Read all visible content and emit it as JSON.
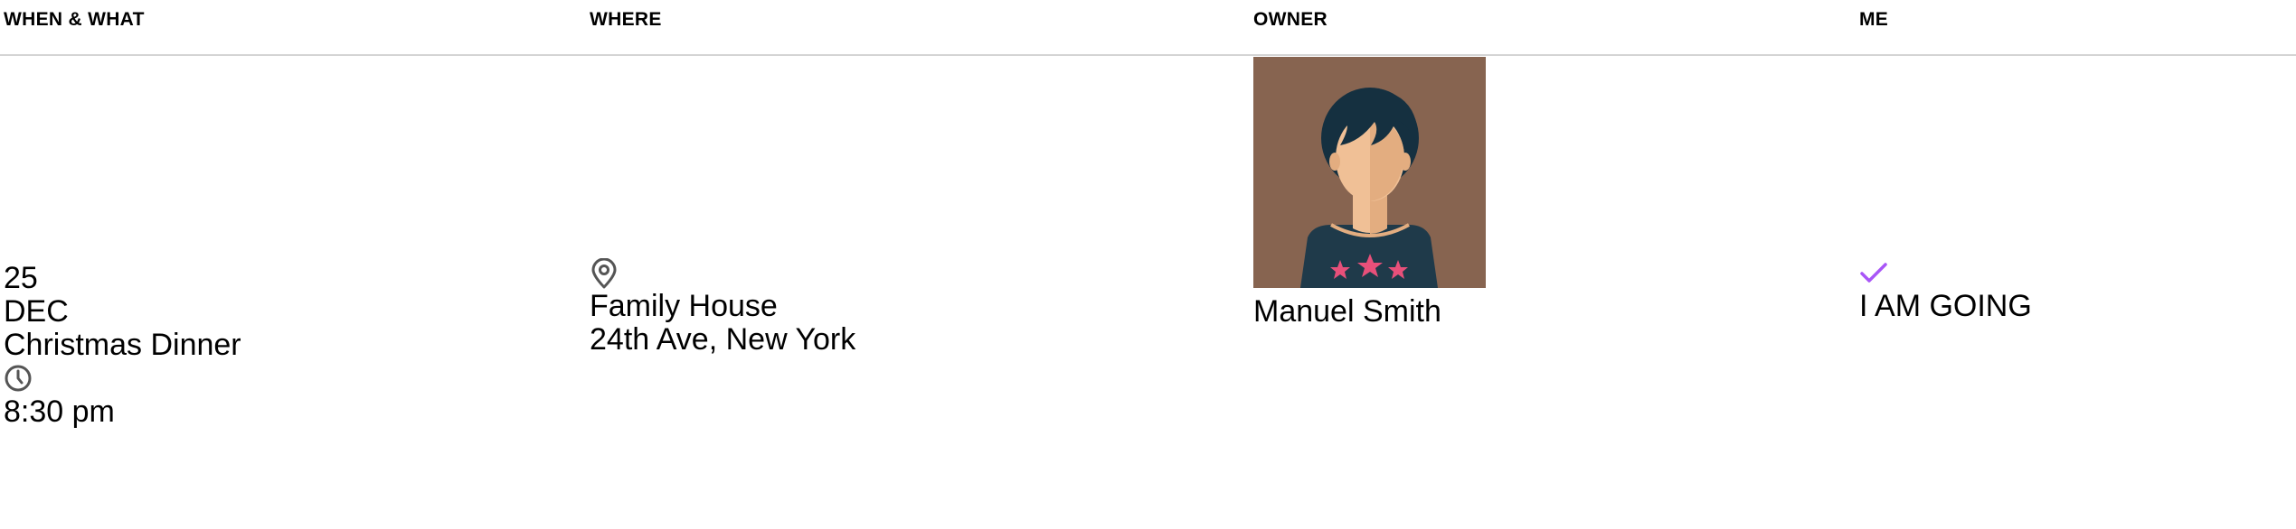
{
  "table": {
    "headers": {
      "when_what": "WHEN & WHAT",
      "where": "WHERE",
      "owner": "OWNER",
      "me": "ME"
    }
  },
  "event": {
    "day": "25",
    "month": "DEC",
    "title": "Christmas Dinner",
    "time": "8:30 pm",
    "location_name": "Family House",
    "location_address": "24th Ave, New York",
    "owner_name": "Manuel Smith",
    "status": "I AM GOING"
  },
  "icons": {
    "clock": "clock-icon",
    "location": "map-pin-icon",
    "status": "checkmark-icon",
    "avatar": "user-avatar-illustration"
  },
  "colors": {
    "accent": "#a855f7",
    "avatar_bg": "#876450",
    "shirt": "#1f3a4a",
    "hair": "#153040",
    "skin": "#f0c096",
    "skin_shadow": "#e3ad80",
    "stars": "#e8507a",
    "divider": "#d4d4d4",
    "icon_gray": "#555555"
  }
}
